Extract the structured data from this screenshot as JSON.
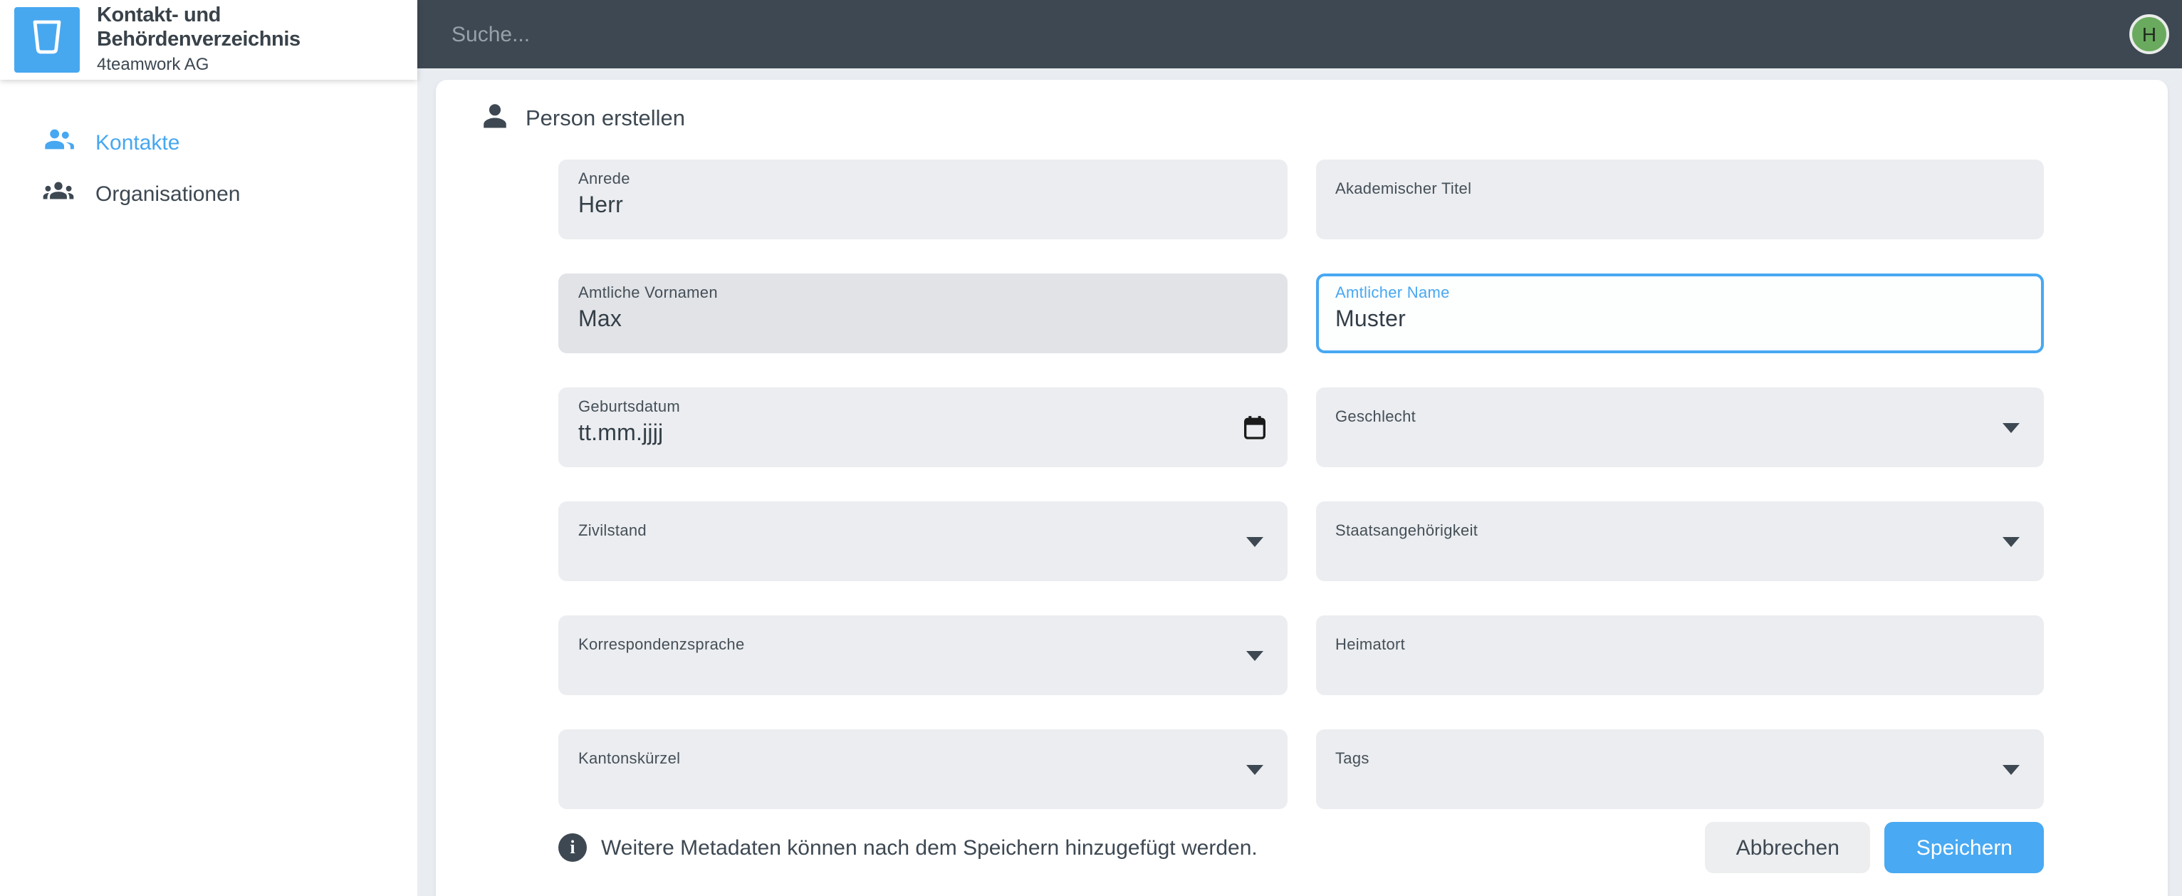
{
  "brand": {
    "title": "Kontakt- und Behördenverzeichnis",
    "subtitle": "4teamwork AG"
  },
  "topbar": {
    "search_placeholder": "Suche...",
    "search_value": "",
    "avatar_initial": "H"
  },
  "sidebar": {
    "items": [
      {
        "label": "Kontakte",
        "icon": "people-icon",
        "active": true
      },
      {
        "label": "Organisationen",
        "icon": "groups-icon",
        "active": false
      }
    ]
  },
  "main": {
    "form_title": "Person erstellen",
    "fields": [
      {
        "label": "Anrede",
        "value": "Herr",
        "type": "text",
        "state": "filled"
      },
      {
        "label": "Akademischer Titel",
        "value": "",
        "type": "text",
        "state": "empty"
      },
      {
        "label": "Amtliche Vornamen",
        "value": "Max",
        "type": "text",
        "state": "filled-hover"
      },
      {
        "label": "Amtlicher Name",
        "value": "Muster",
        "type": "text",
        "state": "focused"
      },
      {
        "label": "Geburtsdatum",
        "value": "tt.mm.jjjj",
        "type": "date",
        "state": "placeholder"
      },
      {
        "label": "Geschlecht",
        "value": "",
        "type": "select",
        "state": "empty"
      },
      {
        "label": "Zivilstand",
        "value": "",
        "type": "select",
        "state": "empty"
      },
      {
        "label": "Staatsangehörigkeit",
        "value": "",
        "type": "select",
        "state": "empty"
      },
      {
        "label": "Korrespondenzsprache",
        "value": "",
        "type": "select",
        "state": "empty"
      },
      {
        "label": "Heimatort",
        "value": "",
        "type": "text",
        "state": "empty"
      },
      {
        "label": "Kantonskürzel",
        "value": "",
        "type": "select",
        "state": "empty"
      },
      {
        "label": "Tags",
        "value": "",
        "type": "select",
        "state": "empty"
      }
    ],
    "footer": {
      "info": "Weitere Metadaten können nach dem Speichern hinzugefügt werden.",
      "cancel_label": "Abbrechen",
      "save_label": "Speichern"
    }
  },
  "colors": {
    "accent_blue": "#47a8f0",
    "topbar_dark": "#3d4852",
    "field_gray": "#ebedf0",
    "avatar_green": "#6aaa5e",
    "page_background": "#e9edf1"
  }
}
